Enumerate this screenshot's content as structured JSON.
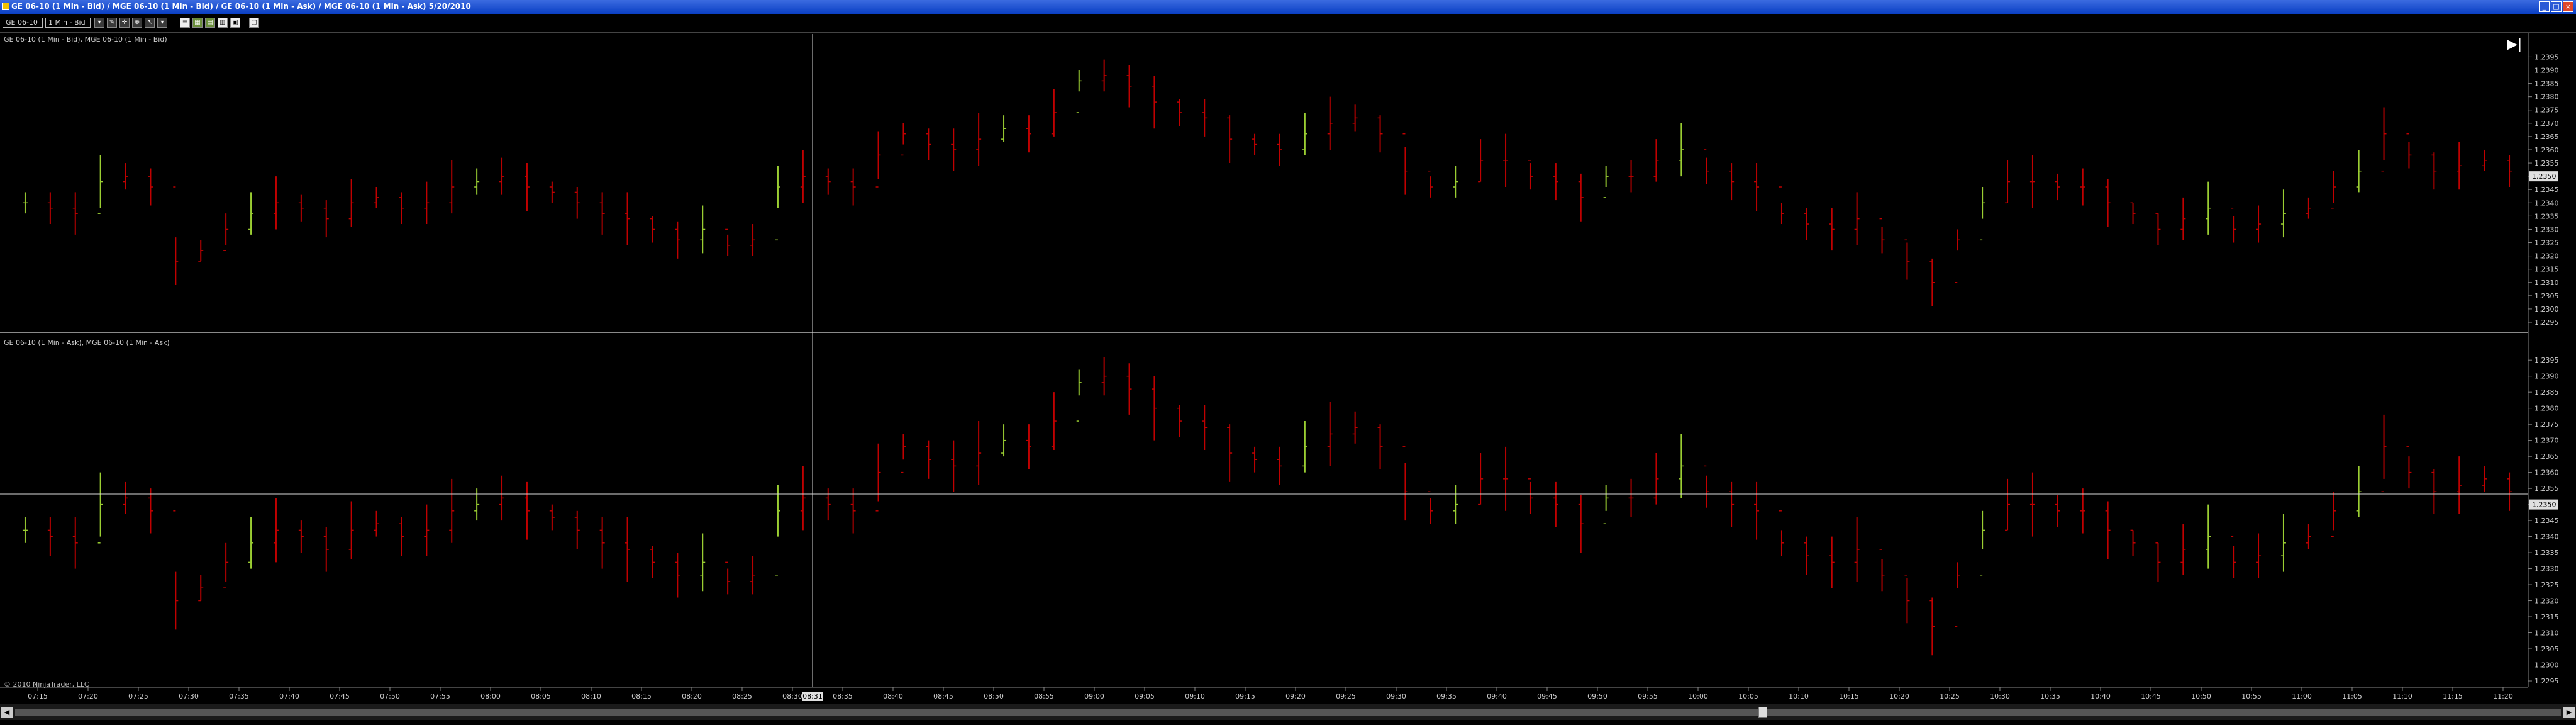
{
  "window": {
    "title": "GE 06-10 (1 Min - Bid) / MGE 06-10 (1 Min - Bid) / GE 06-10 (1 Min - Ask) / MGE 06-10 (1 Min - Ask)  5/20/2010"
  },
  "toolbar": {
    "instrument": "GE 06-10",
    "interval": "1 Min - Bid"
  },
  "panels": {
    "top_label": "GE 06-10 (1 Min - Bid), MGE 06-10 (1 Min - Bid)",
    "bottom_label": "GE 06-10 (1 Min - Ask), MGE 06-10 (1 Min - Ask)"
  },
  "copyright": "© 2010 NinjaTrader, LLC",
  "colors": {
    "bar_up": "#9acd32",
    "bar_down": "#c00000",
    "crosshair": "#d8d8d8",
    "axis_text": "#cccccc"
  },
  "chart_data": [
    {
      "type": "ohlc",
      "name": "top",
      "title": "",
      "ylim": [
        1.2295,
        1.2397
      ],
      "y_ticks": [
        "1.2395",
        "1.2390",
        "1.2385",
        "1.2380",
        "1.2375",
        "1.2370",
        "1.2365",
        "1.2360",
        "1.2355",
        "1.2350",
        "1.2345",
        "1.2340",
        "1.2335",
        "1.2330",
        "1.2325",
        "1.2320",
        "1.2315",
        "1.2310",
        "1.2305",
        "1.2300",
        "1.2295"
      ],
      "price_marker": "1.2350",
      "series": [
        {
          "name": "",
          "values": [
            1.234,
            1.2338,
            1.2336,
            1.2348,
            1.235,
            1.2346,
            1.2318,
            1.2322,
            1.233,
            1.2336,
            1.234,
            1.2338,
            1.2334,
            1.234,
            1.2342,
            1.2338,
            1.234,
            1.2346,
            1.2348,
            1.235,
            1.2346,
            1.2344,
            1.234,
            1.2336,
            1.2334,
            1.233,
            1.2326,
            1.233,
            1.2324,
            1.2326,
            1.2346,
            1.235,
            1.2348,
            1.2346,
            1.2358,
            1.2366,
            1.2362,
            1.236,
            1.2364,
            1.2368,
            1.2366,
            1.2374,
            1.2386,
            1.2388,
            1.2384,
            1.2378,
            1.2374,
            1.2372,
            1.2364,
            1.2362,
            1.236,
            1.2366,
            1.237,
            1.2372,
            1.2366,
            1.2352,
            1.2346,
            1.2348,
            1.2356,
            1.2356,
            1.235,
            1.2348,
            1.2342,
            1.235,
            1.235,
            1.2356,
            1.236,
            1.2352,
            1.2348,
            1.2346,
            1.2336,
            1.2332,
            1.233,
            1.2334,
            1.2326,
            1.2318,
            1.231,
            1.2326,
            1.234,
            1.2348,
            1.2348,
            1.2346,
            1.2346,
            1.234,
            1.2336,
            1.233,
            1.2334,
            1.2338,
            1.233,
            1.2332,
            1.2336,
            1.2338,
            1.2346,
            1.2352,
            1.2366,
            1.2358,
            1.2352,
            1.2354,
            1.2356,
            1.2352
          ]
        }
      ]
    },
    {
      "type": "ohlc",
      "name": "bottom",
      "title": "",
      "ylim": [
        1.2295,
        1.2397
      ],
      "y_ticks": [
        "1.2395",
        "1.2390",
        "1.2385",
        "1.2380",
        "1.2375",
        "1.2370",
        "1.2365",
        "1.2360",
        "1.2355",
        "1.2350",
        "1.2345",
        "1.2340",
        "1.2335",
        "1.2330",
        "1.2325",
        "1.2320",
        "1.2315",
        "1.2310",
        "1.2305",
        "1.2300",
        "1.2295"
      ],
      "price_marker": "1.2350",
      "series": [
        {
          "name": "",
          "values": [
            1.2342,
            1.234,
            1.2338,
            1.235,
            1.2352,
            1.2348,
            1.232,
            1.2324,
            1.2332,
            1.2338,
            1.2342,
            1.234,
            1.2336,
            1.2342,
            1.2344,
            1.234,
            1.2342,
            1.2348,
            1.235,
            1.2352,
            1.2348,
            1.2346,
            1.2342,
            1.2338,
            1.2336,
            1.2332,
            1.2328,
            1.2332,
            1.2326,
            1.2328,
            1.2348,
            1.2352,
            1.235,
            1.2348,
            1.236,
            1.2368,
            1.2364,
            1.2362,
            1.2366,
            1.237,
            1.2368,
            1.2376,
            1.2388,
            1.239,
            1.2386,
            1.238,
            1.2376,
            1.2374,
            1.2366,
            1.2364,
            1.2362,
            1.2368,
            1.2372,
            1.2374,
            1.2368,
            1.2354,
            1.2348,
            1.235,
            1.2358,
            1.2358,
            1.2352,
            1.235,
            1.2344,
            1.2352,
            1.2352,
            1.2358,
            1.2362,
            1.2354,
            1.235,
            1.2348,
            1.2338,
            1.2334,
            1.2332,
            1.2336,
            1.2328,
            1.232,
            1.2312,
            1.2328,
            1.2342,
            1.235,
            1.235,
            1.2348,
            1.2348,
            1.2342,
            1.2338,
            1.2332,
            1.2336,
            1.234,
            1.2332,
            1.2334,
            1.2338,
            1.234,
            1.2348,
            1.2354,
            1.2368,
            1.236,
            1.2354,
            1.2356,
            1.2358,
            1.2354
          ]
        }
      ]
    }
  ],
  "x_axis": {
    "labels": [
      "07:15",
      "07:20",
      "07:25",
      "07:30",
      "07:35",
      "07:40",
      "07:45",
      "07:50",
      "07:55",
      "08:00",
      "08:05",
      "08:10",
      "08:15",
      "08:20",
      "08:25",
      "08:30",
      "08:35",
      "08:40",
      "08:45",
      "08:50",
      "08:55",
      "09:00",
      "09:05",
      "09:10",
      "09:15",
      "09:20",
      "09:25",
      "09:30",
      "09:35",
      "09:40",
      "09:45",
      "09:50",
      "09:55",
      "10:00",
      "10:05",
      "10:10",
      "10:15",
      "10:20",
      "10:25",
      "10:30",
      "10:35",
      "10:40",
      "10:45",
      "10:50",
      "10:55",
      "11:00",
      "11:05",
      "11:10",
      "11:15",
      "11:20"
    ],
    "cursor_label": "08:31"
  }
}
